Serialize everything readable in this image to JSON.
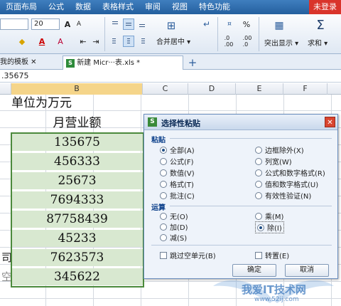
{
  "menu": {
    "items": [
      "页面布局",
      "公式",
      "数据",
      "表格样式",
      "审阅",
      "视图",
      "特色功能"
    ],
    "login": "未登录"
  },
  "toolbar": {
    "font_size": "20",
    "merge_center": "合并居中",
    "number_format_symbol": "%",
    "highlight": "突出显示",
    "sum": "求和"
  },
  "tabs": {
    "template_tab": "我的模板",
    "file_tab": "新建 Micr···表.xls *",
    "add_tab": "+"
  },
  "formula_value": ".35675",
  "columns": [
    "B",
    "C",
    "D",
    "E",
    "F"
  ],
  "sheet": {
    "unit_label": "单位为万元",
    "header": "月营业额",
    "values": [
      "135675",
      "456333",
      "25673",
      "7694333",
      "87758439",
      "45233",
      "7623573",
      "345622"
    ],
    "left_fragments": [
      "司",
      "空"
    ]
  },
  "dialog": {
    "title": "选择性粘贴",
    "paste_group": "粘贴",
    "paste_options_left": [
      {
        "label": "全部(A)",
        "checked": true
      },
      {
        "label": "公式(F)",
        "checked": false
      },
      {
        "label": "数值(V)",
        "checked": false
      },
      {
        "label": "格式(T)",
        "checked": false
      },
      {
        "label": "批注(C)",
        "checked": false
      }
    ],
    "paste_options_right": [
      {
        "label": "边框除外(X)",
        "checked": false
      },
      {
        "label": "列宽(W)",
        "checked": false
      },
      {
        "label": "公式和数字格式(R)",
        "checked": false
      },
      {
        "label": "值和数字格式(U)",
        "checked": false
      },
      {
        "label": "有效性验证(N)",
        "checked": false
      }
    ],
    "operation_group": "运算",
    "op_options_left": [
      {
        "label": "无(O)",
        "checked": false
      },
      {
        "label": "加(D)",
        "checked": false
      },
      {
        "label": "减(S)",
        "checked": false
      }
    ],
    "op_options_right": [
      {
        "label": "乘(M)",
        "checked": false
      },
      {
        "label": "除(I)",
        "checked": true
      }
    ],
    "skip_blanks": "跳过空单元(B)",
    "transpose": "转置(E)",
    "ok": "确定",
    "cancel": "取消"
  },
  "watermark": {
    "text": "我爱IT技术网",
    "url": "www.52ij.com"
  },
  "colors": {
    "accent": "#245f9e",
    "selection_border": "#4b8a3c",
    "cell_shade": "#d8e8d0"
  }
}
